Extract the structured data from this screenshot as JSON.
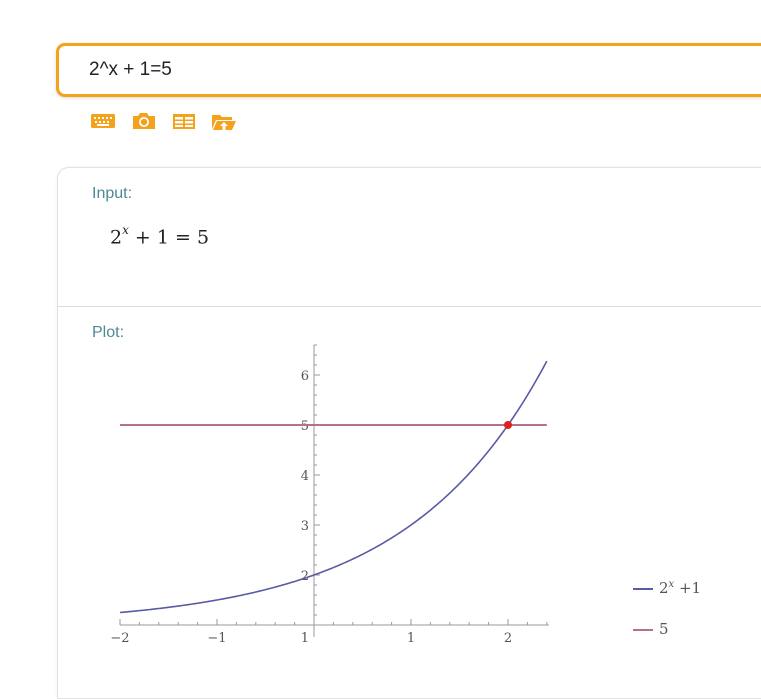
{
  "search": {
    "query": "2^x + 1=5"
  },
  "toolbar": {
    "icons": [
      "keyboard-icon",
      "camera-icon",
      "table-icon",
      "folder-upload-icon"
    ],
    "icon_color": "#f4a21c"
  },
  "input_pod": {
    "title": "Input:",
    "expr_base": "2",
    "expr_exponent": "x",
    "expr_rest": "+ 1 = 5"
  },
  "plot_pod": {
    "title": "Plot:"
  },
  "legend": {
    "curve_base": "2",
    "curve_exponent": "x",
    "curve_rest": "+1",
    "line_label": "5"
  },
  "chart_data": {
    "type": "line",
    "title": "",
    "xlabel": "",
    "ylabel": "",
    "xlim": [
      -2,
      2.4
    ],
    "ylim": [
      1,
      6.6
    ],
    "xticks": [
      -2,
      -1,
      1,
      2
    ],
    "xtick_labels": [
      "-2",
      "-1",
      "1",
      "2"
    ],
    "yticks": [
      2,
      3,
      4,
      5,
      6
    ],
    "ytick_labels": [
      "2",
      "3",
      "4",
      "5",
      "6"
    ],
    "origin_label": "1",
    "series": [
      {
        "name": "2^x +1",
        "color": "#5b5aa6",
        "x": [
          -2,
          -1.5,
          -1,
          -0.5,
          0,
          0.5,
          1,
          1.5,
          2,
          2.4
        ],
        "y": [
          1.25,
          1.35,
          1.5,
          1.71,
          2,
          2.41,
          3,
          3.83,
          5,
          6.28
        ]
      },
      {
        "name": "5",
        "color": "#b5718c",
        "x": [
          -2,
          2.4
        ],
        "y": [
          5,
          5
        ]
      }
    ],
    "intersection": {
      "x": 2,
      "y": 5,
      "color": "#e02020"
    },
    "grid": false,
    "legend_position": "right"
  }
}
